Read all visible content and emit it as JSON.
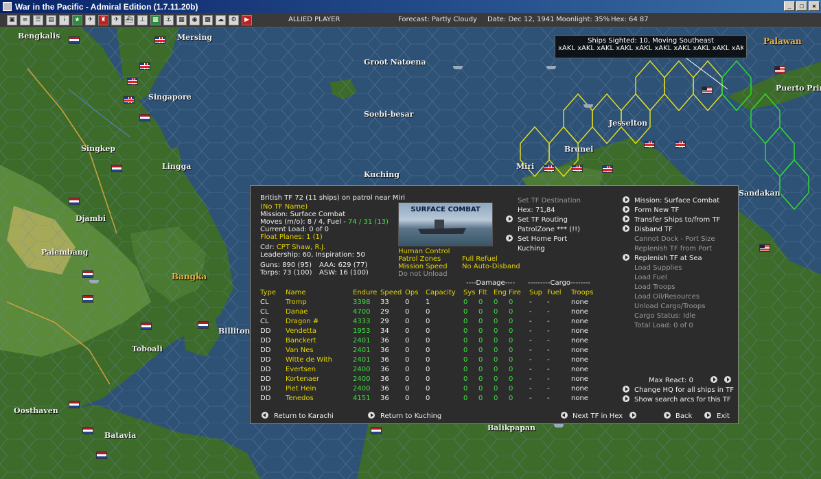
{
  "window": {
    "title": "War in the Pacific - Admiral Edition (1.7.11.20b)",
    "controls": [
      "_",
      "□",
      "×"
    ]
  },
  "toolbar": {
    "player": "ALLIED PLAYER",
    "forecast": "Forecast: Partly Cloudy",
    "date": "Date: Dec 12, 1941",
    "moonlight": "Moonlight: 35%",
    "hex": "Hex: 64 87"
  },
  "map": {
    "labels": {
      "bengkalis": "Bengkalis",
      "mersing": "Mersing",
      "groot_natoena": "Groot Natoena",
      "singapore": "Singapore",
      "soebi_besar": "Soebi-besar",
      "singkep": "Singkep",
      "lingga": "Lingga",
      "kuching": "Kuching",
      "djambi": "Djambi",
      "palembang": "Palembang",
      "bangka": "Bangka",
      "billiton": "Billiton",
      "toboali": "Toboali",
      "oosthaven": "Oosthaven",
      "batavia": "Batavia",
      "balikpapan": "Balikpapan",
      "brunei": "Brunei",
      "jesselton": "Jesselton",
      "miri": "Miri",
      "palawan": "Palawan",
      "puerto_princesa": "Puerto Prin",
      "sandakan": "Sandakan"
    }
  },
  "sighting": {
    "title": "Ships Sighted: 10, Moving Southeast",
    "ships": "xAKL xAKL xAKL xAKL xAKL xAKL xAKL xAKL xAKL xAKL"
  },
  "tf": {
    "header": "British TF 72 (11 ships)  on patrol near Miri",
    "tf_name": "(No TF Name)",
    "mission": "Mission: Surface Combat",
    "moves_label": "Moves (m/o): 8 / 4, Fuel - ",
    "moves_fuel": "74 / 31 (13)",
    "current_load": "Current Load: 0 of 0",
    "float_planes": "Float Planes: 1 (1)",
    "cdr_label": "Cdr:",
    "cdr_name": "CPT Shaw, R.J.",
    "leadership": "Leadership: 60, Inspiration: 50",
    "guns": "Guns: 890 (95)",
    "aaa": "AAA: 629 (77)",
    "torps": "Torps: 73 (100)",
    "asw": "ASW: 16 (100)",
    "combat_image_label": "SURFACE COMBAT",
    "control": {
      "human": "Human Control",
      "patrol_zones": "Patrol Zones",
      "full_refuel": "Full Refuel",
      "mission_speed": "Mission Speed",
      "no_auto_disband": "No Auto-Disband",
      "do_not_unload": "Do not Unload"
    },
    "destination": {
      "set_tf_destination": "Set TF Destination",
      "hex": "Hex: 71,84",
      "set_tf_routing": "Set TF Routing",
      "patrol_zone": "PatrolZone *** (!!)",
      "set_home_port": "Set Home Port",
      "home_port": "Kuching"
    },
    "commands": {
      "mission": "Mission: Surface Combat",
      "form_new_tf": "Form New TF",
      "transfer_ships": "Transfer Ships to/from TF",
      "disband_tf": "Disband TF",
      "cannot_dock": "Cannot Dock - Port Size",
      "replenish_port": "Replenish TF from Port",
      "replenish_sea": "Replenish TF at Sea",
      "load_supplies": "Load Supplies",
      "load_fuel": "Load Fuel",
      "load_troops": "Load Troops",
      "load_oil": "Load Oil/Resources",
      "unload_cargo": "Unload Cargo/Troops",
      "cargo_status": "Cargo Status: Idle",
      "total_load": "Total Load: 0 of 0"
    },
    "max_react": "Max React: 0",
    "change_hq": "Change HQ for all ships in TF",
    "show_search_arcs": "Show search arcs for this TF",
    "group_headers": {
      "damage": "----Damage----",
      "cargo": "---------Cargo--------"
    },
    "columns": [
      "Type",
      "Name",
      "Endure",
      "Speed",
      "Ops",
      "Capacity",
      "Sys",
      "Flt",
      "Eng",
      "Fire",
      "Sup",
      "Fuel",
      "Troops"
    ],
    "ships": [
      {
        "type": "CL",
        "name": "Tromp",
        "endure": "3398",
        "speed": "33",
        "ops": "0",
        "capacity": "1",
        "sys": "0",
        "flt": "0",
        "eng": "0",
        "fire": "0",
        "sup": "-",
        "fuel": "-",
        "troops": "none"
      },
      {
        "type": "CL",
        "name": "Danae",
        "endure": "4700",
        "speed": "29",
        "ops": "0",
        "capacity": "0",
        "sys": "0",
        "flt": "0",
        "eng": "0",
        "fire": "0",
        "sup": "-",
        "fuel": "-",
        "troops": "none"
      },
      {
        "type": "CL",
        "name": "Dragon #",
        "endure": "4333",
        "speed": "29",
        "ops": "0",
        "capacity": "0",
        "sys": "0",
        "flt": "0",
        "eng": "0",
        "fire": "0",
        "sup": "-",
        "fuel": "-",
        "troops": "none"
      },
      {
        "type": "DD",
        "name": "Vendetta",
        "endure": "1953",
        "speed": "34",
        "ops": "0",
        "capacity": "0",
        "sys": "0",
        "flt": "0",
        "eng": "0",
        "fire": "0",
        "sup": "-",
        "fuel": "-",
        "troops": "none"
      },
      {
        "type": "DD",
        "name": "Banckert",
        "endure": "2401",
        "speed": "36",
        "ops": "0",
        "capacity": "0",
        "sys": "0",
        "flt": "0",
        "eng": "0",
        "fire": "0",
        "sup": "-",
        "fuel": "-",
        "troops": "none"
      },
      {
        "type": "DD",
        "name": "Van Nes",
        "endure": "2401",
        "speed": "36",
        "ops": "0",
        "capacity": "0",
        "sys": "0",
        "flt": "0",
        "eng": "0",
        "fire": "0",
        "sup": "-",
        "fuel": "-",
        "troops": "none"
      },
      {
        "type": "DD",
        "name": "Witte de With",
        "endure": "2401",
        "speed": "36",
        "ops": "0",
        "capacity": "0",
        "sys": "0",
        "flt": "0",
        "eng": "0",
        "fire": "0",
        "sup": "-",
        "fuel": "-",
        "troops": "none"
      },
      {
        "type": "DD",
        "name": "Evertsen",
        "endure": "2400",
        "speed": "36",
        "ops": "0",
        "capacity": "0",
        "sys": "0",
        "flt": "0",
        "eng": "0",
        "fire": "0",
        "sup": "-",
        "fuel": "-",
        "troops": "none"
      },
      {
        "type": "DD",
        "name": "Kortenaer",
        "endure": "2400",
        "speed": "36",
        "ops": "0",
        "capacity": "0",
        "sys": "0",
        "flt": "0",
        "eng": "0",
        "fire": "0",
        "sup": "-",
        "fuel": "-",
        "troops": "none"
      },
      {
        "type": "DD",
        "name": "Piet Hein",
        "endure": "2400",
        "speed": "36",
        "ops": "0",
        "capacity": "0",
        "sys": "0",
        "flt": "0",
        "eng": "0",
        "fire": "0",
        "sup": "-",
        "fuel": "-",
        "troops": "none"
      },
      {
        "type": "DD",
        "name": "Tenedos",
        "endure": "4151",
        "speed": "36",
        "ops": "0",
        "capacity": "0",
        "sys": "0",
        "flt": "0",
        "eng": "0",
        "fire": "0",
        "sup": "-",
        "fuel": "-",
        "troops": "none"
      }
    ],
    "footer": {
      "return_karachi": "Return to Karachi",
      "return_kuching": "Return to Kuching",
      "next_tf": "Next TF in Hex",
      "back": "Back",
      "exit": "Exit"
    }
  },
  "colors": {
    "text_yellow": "#e6d400",
    "text_green": "#40e040",
    "panel_bg": "#2c2c2c",
    "sea": "#2a4a6a",
    "land": "#3d6b2a",
    "hex_highlight_yellow": "#e8e020",
    "hex_highlight_green": "#30e030"
  }
}
